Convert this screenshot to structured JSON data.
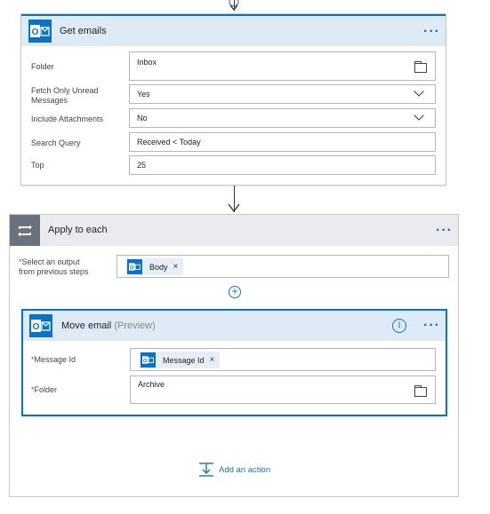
{
  "get_emails": {
    "title": "Get emails",
    "more": "···",
    "fields": {
      "folder": {
        "label": "Folder",
        "value": "Inbox"
      },
      "fetch_unread": {
        "label_line1": "Fetch Only Unread",
        "label_line2": "Messages",
        "value": "Yes"
      },
      "include_attachments": {
        "label": "Include Attachments",
        "value": "No"
      },
      "search_query": {
        "label": "Search Query",
        "value": "Received < Today"
      },
      "top": {
        "label": "Top",
        "value": "25"
      }
    }
  },
  "apply_to_each": {
    "title": "Apply to each",
    "more": "···",
    "select_output": {
      "required_mark": "*",
      "label_line1": "Select an output",
      "label_line2": "from previous steps",
      "token": "Body",
      "token_remove": "×"
    },
    "insert": "+",
    "move_email": {
      "title": "Move email",
      "preview": "(Preview)",
      "info": "i",
      "more": "···",
      "message_id": {
        "required_mark": "*",
        "label": "Message Id",
        "token": "Message Id",
        "token_remove": "×"
      },
      "folder": {
        "required_mark": "*",
        "label": "Folder",
        "value": "Archive"
      }
    },
    "add_action": "Add an action"
  },
  "icons": {
    "outlook": "outlook-icon",
    "loop": "loop-icon",
    "add_action": "add-action-icon"
  },
  "colors": {
    "accent": "#0b72c5",
    "link": "#1a73c7",
    "header_bg": "#deeaf6",
    "loop_bg": "#e9ebee",
    "loop_icon_bg": "#6a737d"
  }
}
